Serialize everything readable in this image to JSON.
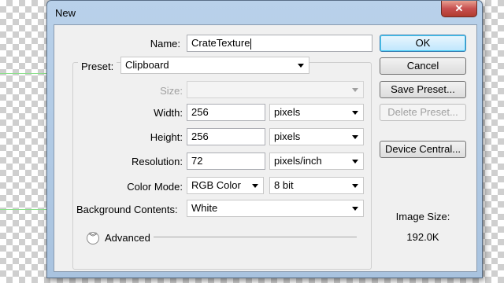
{
  "dialog": {
    "title": "New",
    "close_glyph": "✕",
    "fields": {
      "name": {
        "label": "Name:",
        "value": "CrateTexture"
      },
      "preset": {
        "label": "Preset:",
        "value": "Clipboard"
      },
      "size": {
        "label": "Size:",
        "value": ""
      },
      "width": {
        "label": "Width:",
        "value": "256",
        "unit": "pixels"
      },
      "height": {
        "label": "Height:",
        "value": "256",
        "unit": "pixels"
      },
      "resolution": {
        "label": "Resolution:",
        "value": "72",
        "unit": "pixels/inch"
      },
      "color_mode": {
        "label": "Color Mode:",
        "value": "RGB Color",
        "depth": "8 bit"
      },
      "background": {
        "label": "Background Contents:",
        "value": "White"
      }
    },
    "advanced": {
      "label": "Advanced",
      "icon": "chevron-double-down-icon",
      "glyph": "︾"
    },
    "buttons": {
      "ok": "OK",
      "cancel": "Cancel",
      "save_preset": "Save Preset...",
      "delete_preset": "Delete Preset...",
      "device_central": "Device Central..."
    },
    "image_size": {
      "label": "Image Size:",
      "value": "192.0K"
    }
  },
  "colors": {
    "title_bar": "#b9d1ea",
    "close_button": "#c75050",
    "dialog_background": "#f0f0f0",
    "guide_line": "#8fe08f"
  }
}
